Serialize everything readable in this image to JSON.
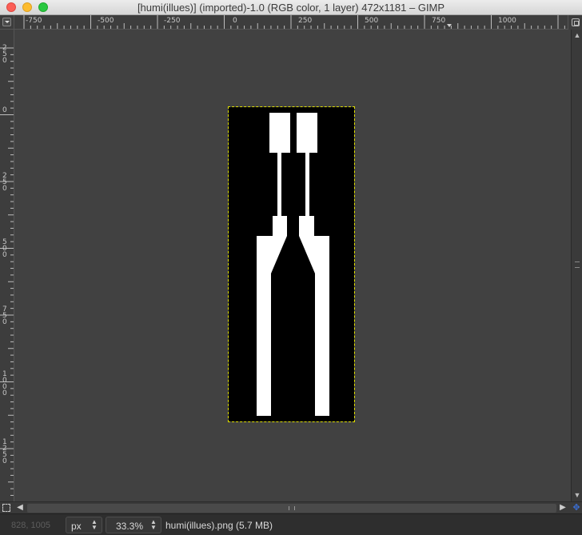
{
  "window": {
    "title": "[humi(illues)] (imported)-1.0 (RGB color, 1 layer) 472x1181 – GIMP"
  },
  "rulers": {
    "horizontal_labels": [
      "-750",
      "-500",
      "-250",
      "0",
      "250",
      "500",
      "750",
      "1000"
    ],
    "vertical_labels": [
      "2\n5\n0",
      "0",
      "2\n5\n0",
      "5\n0\n0",
      "7\n5\n0",
      "1\n0\n0\n0",
      "1\n2\n5\n0"
    ]
  },
  "canvas": {
    "image_background": "#000000",
    "canvas_background": "#414141",
    "selection_color": "#e0e000",
    "shape_color": "#ffffff"
  },
  "statusbar": {
    "coordinates": "828, 1005",
    "unit": "px",
    "zoom": "33.3%",
    "message": "humi(illues).png (5.7 MB)"
  },
  "icons": {
    "corner": "menu-triangle-icon",
    "navigate": "navigate-icon",
    "quick_mask": "quick-mask-icon",
    "zoom_spinner": "spinner-icon"
  }
}
